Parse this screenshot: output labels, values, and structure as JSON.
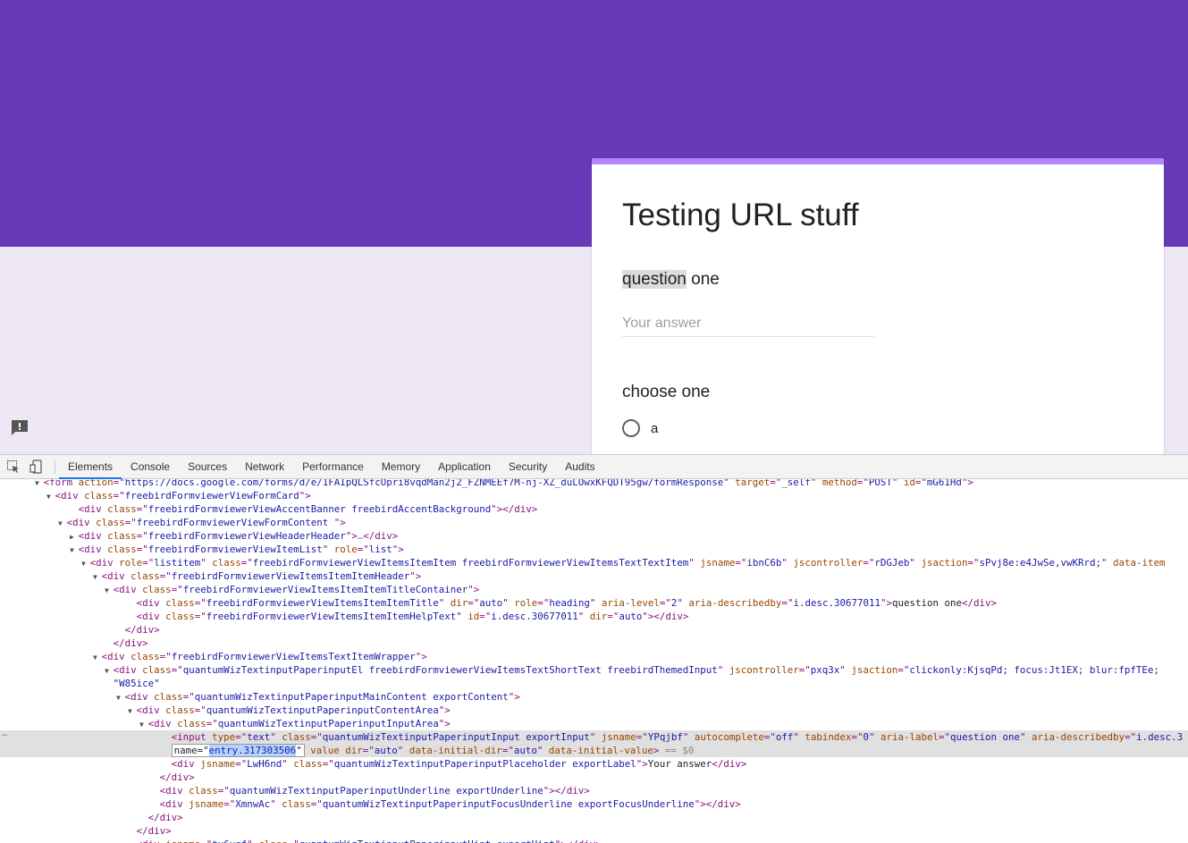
{
  "form": {
    "title": "Testing URL stuff",
    "q1_title_highlight": "question",
    "q1_title_rest": " one",
    "q1_placeholder": "Your answer",
    "q2_title": "choose one",
    "q2_option": "a"
  },
  "colors": {
    "banner": "#673ab7",
    "background": "#ede7f6",
    "accent": "#b388ff"
  },
  "icons": {
    "feedback": "feedback-icon",
    "inspect": "inspect-element-icon",
    "device": "device-toolbar-icon"
  },
  "devtools": {
    "tabs": [
      "Elements",
      "Console",
      "Sources",
      "Network",
      "Performance",
      "Memory",
      "Application",
      "Security",
      "Audits"
    ],
    "active_tab": "Elements",
    "lines": [
      {
        "indent": 4,
        "tri": "▼",
        "parts": [
          [
            "tag",
            "<form "
          ],
          [
            "attr",
            "action"
          ],
          [
            "tag",
            "=\""
          ],
          [
            "val",
            "https://docs.google.com/forms/d/e/1FAIpQLSfcOpri8vqdMan2j2_FZNMEEf7M-nj-XZ_duLOwxKFQDT95gw/formResponse"
          ],
          [
            "tag",
            "\" "
          ],
          [
            "attr",
            "target"
          ],
          [
            "tag",
            "=\""
          ],
          [
            "val",
            "_self"
          ],
          [
            "tag",
            "\" "
          ],
          [
            "attr",
            "method"
          ],
          [
            "tag",
            "=\""
          ],
          [
            "val",
            "POST"
          ],
          [
            "tag",
            "\" "
          ],
          [
            "attr",
            "id"
          ],
          [
            "tag",
            "=\""
          ],
          [
            "val",
            "mG61Hd"
          ],
          [
            "tag",
            "\">"
          ]
        ]
      },
      {
        "indent": 5,
        "tri": "▼",
        "parts": [
          [
            "tag",
            "<div "
          ],
          [
            "attr",
            "class"
          ],
          [
            "tag",
            "=\""
          ],
          [
            "val",
            "freebirdFormviewerViewFormCard"
          ],
          [
            "tag",
            "\">"
          ]
        ]
      },
      {
        "indent": 7,
        "tri": "",
        "parts": [
          [
            "tag",
            "<div "
          ],
          [
            "attr",
            "class"
          ],
          [
            "tag",
            "=\""
          ],
          [
            "val",
            "freebirdFormviewerViewAccentBanner freebirdAccentBackground"
          ],
          [
            "tag",
            "\"></div>"
          ]
        ]
      },
      {
        "indent": 6,
        "tri": "▼",
        "parts": [
          [
            "tag",
            "<div "
          ],
          [
            "attr",
            "class"
          ],
          [
            "tag",
            "=\""
          ],
          [
            "val",
            "freebirdFormviewerViewFormContent "
          ],
          [
            "tag",
            "\">"
          ]
        ]
      },
      {
        "indent": 7,
        "tri": "▶",
        "parts": [
          [
            "tag",
            "<div "
          ],
          [
            "attr",
            "class"
          ],
          [
            "tag",
            "=\""
          ],
          [
            "val",
            "freebirdFormviewerViewHeaderHeader"
          ],
          [
            "tag",
            "\">"
          ],
          [
            "dim",
            "…"
          ],
          [
            "tag",
            "</div>"
          ]
        ]
      },
      {
        "indent": 7,
        "tri": "▼",
        "parts": [
          [
            "tag",
            "<div "
          ],
          [
            "attr",
            "class"
          ],
          [
            "tag",
            "=\""
          ],
          [
            "val",
            "freebirdFormviewerViewItemList"
          ],
          [
            "tag",
            "\" "
          ],
          [
            "attr",
            "role"
          ],
          [
            "tag",
            "=\""
          ],
          [
            "val",
            "list"
          ],
          [
            "tag",
            "\">"
          ]
        ]
      },
      {
        "indent": 8,
        "tri": "▼",
        "parts": [
          [
            "tag",
            "<div "
          ],
          [
            "attr",
            "role"
          ],
          [
            "tag",
            "=\""
          ],
          [
            "val",
            "listitem"
          ],
          [
            "tag",
            "\" "
          ],
          [
            "attr",
            "class"
          ],
          [
            "tag",
            "=\""
          ],
          [
            "val",
            "freebirdFormviewerViewItemsItemItem freebirdFormviewerViewItemsTextTextItem"
          ],
          [
            "tag",
            "\" "
          ],
          [
            "attr",
            "jsname"
          ],
          [
            "tag",
            "=\""
          ],
          [
            "val",
            "ibnC6b"
          ],
          [
            "tag",
            "\" "
          ],
          [
            "attr",
            "jscontroller"
          ],
          [
            "tag",
            "=\""
          ],
          [
            "val",
            "rDGJeb"
          ],
          [
            "tag",
            "\" "
          ],
          [
            "attr",
            "jsaction"
          ],
          [
            "tag",
            "=\""
          ],
          [
            "val",
            "sPvj8e:e4JwSe,vwKRrd;"
          ],
          [
            "tag",
            "\" "
          ],
          [
            "attr",
            "data-item"
          ]
        ]
      },
      {
        "indent": 9,
        "tri": "▼",
        "parts": [
          [
            "tag",
            "<div "
          ],
          [
            "attr",
            "class"
          ],
          [
            "tag",
            "=\""
          ],
          [
            "val",
            "freebirdFormviewerViewItemsItemItemHeader"
          ],
          [
            "tag",
            "\">"
          ]
        ]
      },
      {
        "indent": 10,
        "tri": "▼",
        "parts": [
          [
            "tag",
            "<div "
          ],
          [
            "attr",
            "class"
          ],
          [
            "tag",
            "=\""
          ],
          [
            "val",
            "freebirdFormviewerViewItemsItemItemTitleContainer"
          ],
          [
            "tag",
            "\">"
          ]
        ]
      },
      {
        "indent": 12,
        "tri": "",
        "parts": [
          [
            "tag",
            "<div "
          ],
          [
            "attr",
            "class"
          ],
          [
            "tag",
            "=\""
          ],
          [
            "val",
            "freebirdFormviewerViewItemsItemItemTitle"
          ],
          [
            "tag",
            "\" "
          ],
          [
            "attr",
            "dir"
          ],
          [
            "tag",
            "=\""
          ],
          [
            "val",
            "auto"
          ],
          [
            "tag",
            "\" "
          ],
          [
            "attr",
            "role"
          ],
          [
            "tag",
            "=\""
          ],
          [
            "val",
            "heading"
          ],
          [
            "tag",
            "\" "
          ],
          [
            "attr",
            "aria-level"
          ],
          [
            "tag",
            "=\""
          ],
          [
            "val",
            "2"
          ],
          [
            "tag",
            "\" "
          ],
          [
            "attr",
            "aria-describedby"
          ],
          [
            "tag",
            "=\""
          ],
          [
            "val",
            "i.desc.30677011"
          ],
          [
            "tag",
            "\">"
          ],
          [
            "txt",
            "question one"
          ],
          [
            "tag",
            "</div>"
          ]
        ]
      },
      {
        "indent": 12,
        "tri": "",
        "parts": [
          [
            "tag",
            "<div "
          ],
          [
            "attr",
            "class"
          ],
          [
            "tag",
            "=\""
          ],
          [
            "val",
            "freebirdFormviewerViewItemsItemItemHelpText"
          ],
          [
            "tag",
            "\" "
          ],
          [
            "attr",
            "id"
          ],
          [
            "tag",
            "=\""
          ],
          [
            "val",
            "i.desc.30677011"
          ],
          [
            "tag",
            "\" "
          ],
          [
            "attr",
            "dir"
          ],
          [
            "tag",
            "=\""
          ],
          [
            "val",
            "auto"
          ],
          [
            "tag",
            "\"></div>"
          ]
        ]
      },
      {
        "indent": 11,
        "tri": "",
        "parts": [
          [
            "tag",
            "</div>"
          ]
        ]
      },
      {
        "indent": 10,
        "tri": "",
        "parts": [
          [
            "tag",
            "</div>"
          ]
        ]
      },
      {
        "indent": 9,
        "tri": "▼",
        "parts": [
          [
            "tag",
            "<div "
          ],
          [
            "attr",
            "class"
          ],
          [
            "tag",
            "=\""
          ],
          [
            "val",
            "freebirdFormviewerViewItemsTextItemWrapper"
          ],
          [
            "tag",
            "\">"
          ]
        ]
      },
      {
        "indent": 10,
        "tri": "▼",
        "parts": [
          [
            "tag",
            "<div "
          ],
          [
            "attr",
            "class"
          ],
          [
            "tag",
            "=\""
          ],
          [
            "val",
            "quantumWizTextinputPaperinputEl freebirdFormviewerViewItemsTextShortText freebirdThemedInput"
          ],
          [
            "tag",
            "\" "
          ],
          [
            "attr",
            "jscontroller"
          ],
          [
            "tag",
            "=\""
          ],
          [
            "val",
            "pxq3x"
          ],
          [
            "tag",
            "\" "
          ],
          [
            "attr",
            "jsaction"
          ],
          [
            "tag",
            "=\""
          ],
          [
            "val",
            "clickonly:KjsqPd; focus:Jt1EX; blur:fpfTEe;"
          ]
        ]
      },
      {
        "indent": 10,
        "tri": "",
        "parts": [
          [
            "val",
            "\"W85ice\""
          ]
        ]
      },
      {
        "indent": 11,
        "tri": "▼",
        "parts": [
          [
            "tag",
            "<div "
          ],
          [
            "attr",
            "class"
          ],
          [
            "tag",
            "=\""
          ],
          [
            "val",
            "quantumWizTextinputPaperinputMainContent exportContent"
          ],
          [
            "tag",
            "\">"
          ]
        ]
      },
      {
        "indent": 12,
        "tri": "▼",
        "parts": [
          [
            "tag",
            "<div "
          ],
          [
            "attr",
            "class"
          ],
          [
            "tag",
            "=\""
          ],
          [
            "val",
            "quantumWizTextinputPaperinputContentArea"
          ],
          [
            "tag",
            "\">"
          ]
        ]
      },
      {
        "indent": 13,
        "tri": "▼",
        "parts": [
          [
            "tag",
            "<div "
          ],
          [
            "attr",
            "class"
          ],
          [
            "tag",
            "=\""
          ],
          [
            "val",
            "quantumWizTextinputPaperinputInputArea"
          ],
          [
            "tag",
            "\">"
          ]
        ]
      },
      {
        "indent": 15,
        "tri": "",
        "selected": true,
        "parts": [
          [
            "tag",
            "<input "
          ],
          [
            "attr",
            "type"
          ],
          [
            "tag",
            "=\""
          ],
          [
            "val",
            "text"
          ],
          [
            "tag",
            "\" "
          ],
          [
            "attr",
            "class"
          ],
          [
            "tag",
            "=\""
          ],
          [
            "val",
            "quantumWizTextinputPaperinputInput exportInput"
          ],
          [
            "tag",
            "\" "
          ],
          [
            "attr",
            "jsname"
          ],
          [
            "tag",
            "=\""
          ],
          [
            "val",
            "YPqjbf"
          ],
          [
            "tag",
            "\" "
          ],
          [
            "attr",
            "autocomplete"
          ],
          [
            "tag",
            "=\""
          ],
          [
            "val",
            "off"
          ],
          [
            "tag",
            "\" "
          ],
          [
            "attr",
            "tabindex"
          ],
          [
            "tag",
            "=\""
          ],
          [
            "val",
            "0"
          ],
          [
            "tag",
            "\" "
          ],
          [
            "attr",
            "aria-label"
          ],
          [
            "tag",
            "=\""
          ],
          [
            "val",
            "question one"
          ],
          [
            "tag",
            "\" "
          ],
          [
            "attr",
            "aria-describedby"
          ],
          [
            "tag",
            "=\""
          ],
          [
            "val",
            "i.desc.3"
          ]
        ]
      },
      {
        "indent": 15,
        "tri": "",
        "selected": true,
        "namebox": true,
        "parts": [
          [
            "attr",
            " value"
          ],
          [
            "tag",
            " "
          ],
          [
            "attr",
            "dir"
          ],
          [
            "tag",
            "=\""
          ],
          [
            "val",
            "auto"
          ],
          [
            "tag",
            "\" "
          ],
          [
            "attr",
            "data-initial-dir"
          ],
          [
            "tag",
            "=\""
          ],
          [
            "val",
            "auto"
          ],
          [
            "tag",
            "\" "
          ],
          [
            "attr",
            "data-initial-value"
          ],
          [
            "tag",
            "> "
          ],
          [
            "dim",
            "== $0"
          ]
        ]
      },
      {
        "indent": 15,
        "tri": "",
        "parts": [
          [
            "tag",
            "<div "
          ],
          [
            "attr",
            "jsname"
          ],
          [
            "tag",
            "=\""
          ],
          [
            "val",
            "LwH6nd"
          ],
          [
            "tag",
            "\" "
          ],
          [
            "attr",
            "class"
          ],
          [
            "tag",
            "=\""
          ],
          [
            "val",
            "quantumWizTextinputPaperinputPlaceholder exportLabel"
          ],
          [
            "tag",
            "\">"
          ],
          [
            "txt",
            "Your answer"
          ],
          [
            "tag",
            "</div>"
          ]
        ]
      },
      {
        "indent": 14,
        "tri": "",
        "parts": [
          [
            "tag",
            "</div>"
          ]
        ]
      },
      {
        "indent": 14,
        "tri": "",
        "parts": [
          [
            "tag",
            "<div "
          ],
          [
            "attr",
            "class"
          ],
          [
            "tag",
            "=\""
          ],
          [
            "val",
            "quantumWizTextinputPaperinputUnderline exportUnderline"
          ],
          [
            "tag",
            "\"></div>"
          ]
        ]
      },
      {
        "indent": 14,
        "tri": "",
        "parts": [
          [
            "tag",
            "<div "
          ],
          [
            "attr",
            "jsname"
          ],
          [
            "tag",
            "=\""
          ],
          [
            "val",
            "XmnwAc"
          ],
          [
            "tag",
            "\" "
          ],
          [
            "attr",
            "class"
          ],
          [
            "tag",
            "=\""
          ],
          [
            "val",
            "quantumWizTextinputPaperinputFocusUnderline exportFocusUnderline"
          ],
          [
            "tag",
            "\"></div>"
          ]
        ]
      },
      {
        "indent": 13,
        "tri": "",
        "parts": [
          [
            "tag",
            "</div>"
          ]
        ]
      },
      {
        "indent": 12,
        "tri": "",
        "parts": [
          [
            "tag",
            "</div>"
          ]
        ]
      },
      {
        "indent": 12,
        "tri": "",
        "parts": [
          [
            "tag",
            "<div "
          ],
          [
            "attr",
            "jsname"
          ],
          [
            "tag",
            "=\""
          ],
          [
            "val",
            "ty6ygf"
          ],
          [
            "tag",
            "\" "
          ],
          [
            "attr",
            "class"
          ],
          [
            "tag",
            "=\""
          ],
          [
            "val",
            "quantumWizTextinputPaperinputHint exportHint"
          ],
          [
            "tag",
            "\"></div>"
          ]
        ]
      }
    ],
    "namebox_label": "name=\"",
    "namebox_value": "entry.317303506",
    "namebox_close": "\""
  }
}
